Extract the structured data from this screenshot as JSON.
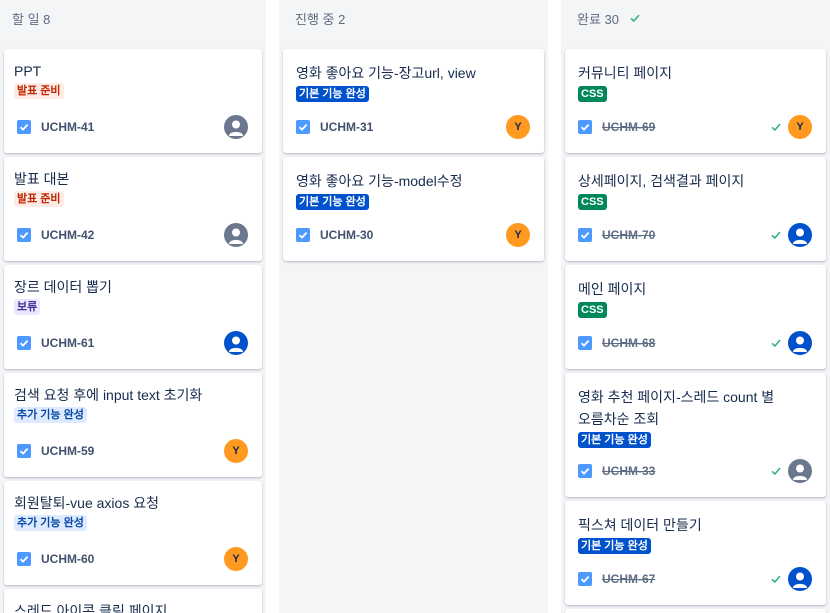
{
  "colors": {
    "column_bg": "#f4f5f7",
    "label_red_bg": "#ffebe6",
    "label_red_fg": "#bf2600",
    "label_purple_bg": "#eae6ff",
    "label_purple_fg": "#403294",
    "label_lightblue_bg": "#deebff",
    "label_lightblue_fg": "#0747a6",
    "label_blue_bg": "#0052cc",
    "label_blue_fg": "#ffffff",
    "label_green_bg": "#00875a",
    "label_green_fg": "#ffffff",
    "check_green": "#36b37e",
    "avatar_orange": "#ff991f",
    "avatar_gray": "#6b778c",
    "avatar_blue": "#0052cc"
  },
  "columns": {
    "todo": {
      "title": "할 일 8",
      "cards": [
        {
          "title": "PPT",
          "label": "발표 준비",
          "key": "UCHM-41",
          "avatar": "user-icon-gray"
        },
        {
          "title": "발표 대본",
          "label": "발표 준비",
          "key": "UCHM-42",
          "avatar": "user-icon-gray"
        },
        {
          "title": "장르 데이터 뽑기",
          "label": "보류",
          "key": "UCHM-61",
          "avatar": "user-icon-blue"
        },
        {
          "title": "검색 요청 후에 input text 초기화",
          "label": "추가 기능 완성",
          "key": "UCHM-59",
          "avatar": "Y"
        },
        {
          "title": "회원탈퇴-vue axios 요청",
          "label": "추가 기능 완성",
          "key": "UCHM-60",
          "avatar": "Y"
        },
        {
          "title": "스레드 아이콘 클릭 페이지"
        }
      ]
    },
    "progress": {
      "title": "진행 중 2",
      "cards": [
        {
          "title": "영화 좋아요 기능-장고url, view",
          "label": "기본 기능 완성",
          "key": "UCHM-31",
          "avatar": "Y"
        },
        {
          "title": "영화 좋아요 기능-model수정",
          "label": "기본 기능 완성",
          "key": "UCHM-30",
          "avatar": "Y"
        }
      ]
    },
    "done": {
      "title": "완료 30",
      "cards": [
        {
          "title": "커뮤니티 페이지",
          "label": "CSS",
          "key": "UCHM-69",
          "avatar": "Y"
        },
        {
          "title": "상세페이지, 검색결과 페이지",
          "label": "CSS",
          "key": "UCHM-70",
          "avatar": "user-icon-blue"
        },
        {
          "title": "메인 페이지",
          "label": "CSS",
          "key": "UCHM-68",
          "avatar": "user-icon-blue"
        },
        {
          "title": "영화 추천 페이지-스레드 count 별 오름차순 조회",
          "label": "기본 기능 완성",
          "key": "UCHM-33",
          "avatar": "user-icon-gray"
        },
        {
          "title": "픽스쳐 데이터 만들기",
          "label": "기본 기능 완성",
          "key": "UCHM-67",
          "avatar": "user-icon-blue"
        }
      ]
    }
  }
}
